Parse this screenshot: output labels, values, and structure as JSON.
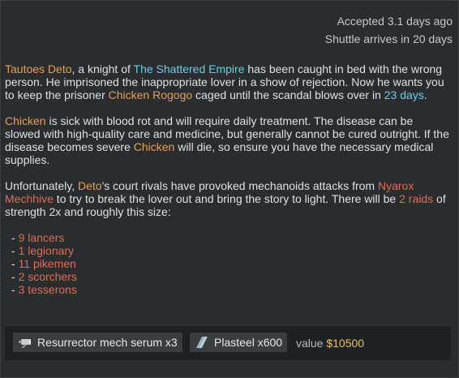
{
  "header": {
    "accepted": "Accepted 3.1 days ago",
    "shuttle": "Shuttle arrives in 20 days"
  },
  "para1": {
    "name": "Tautoes Deto",
    "t1": ", a knight of ",
    "faction": "The Shattered Empire",
    "t2": " has been caught in bed with the wrong person. He imprisoned the inappropriate lover in a show of rejection. Now he wants you to keep the prisoner ",
    "prisoner": "Chicken Rogogo",
    "t3": " caged until the scandal blows over in ",
    "days": "23 days",
    "t4": "."
  },
  "para2": {
    "name1": "Chicken",
    "t1": " is sick with blood rot and will require daily treatment. The disease can be slowed with high-quality care and medicine, but generally cannot be cured outright. If the disease becomes severe ",
    "name2": "Chicken",
    "t2": " will die, so ensure you have the necessary medical supplies."
  },
  "para3": {
    "t1": "Unfortunately, ",
    "name": "Deto",
    "t2": "'s court rivals have provoked mechanoids attacks from ",
    "enemy": "Nyarox Mechhive",
    "t3": " to try to break the lover out and bring the story to light. There will be ",
    "raids": "2 raids",
    "t4": " of strength 2x and roughly this size:"
  },
  "threats": [
    {
      "dash": "- ",
      "label": "9 lancers"
    },
    {
      "dash": "- ",
      "label": "1 legionary"
    },
    {
      "dash": "- ",
      "label": "11 pikemen"
    },
    {
      "dash": "- ",
      "label": "2 scorchers"
    },
    {
      "dash": "- ",
      "label": "3 tesserons"
    }
  ],
  "rewards": {
    "items": [
      {
        "label": "Resurrector mech serum x3",
        "icon": "serum-icon"
      },
      {
        "label": "Plasteel x600",
        "icon": "plasteel-icon"
      }
    ],
    "value_label": "value",
    "value_amount": "$10500"
  },
  "colors": {
    "name": "#e0a05a",
    "faction": "#66d0e6",
    "threat": "#e06a5a",
    "value": "#e5c74a"
  }
}
